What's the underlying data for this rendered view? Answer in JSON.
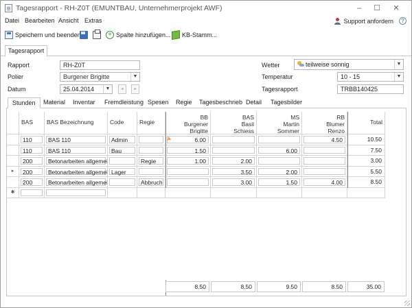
{
  "window": {
    "title": "Tagesrapport - RH-Z0T (EMUNTBAU, Unternehmerprojekt AWF)",
    "minimize": "–",
    "maximize": "☐",
    "close": "✕"
  },
  "menu": {
    "items": [
      "Datei",
      "Bearbeiten",
      "Ansicht",
      "Extras"
    ],
    "support_label": "Support anfordern",
    "help_label": "?"
  },
  "toolbar": {
    "save_close_label": "Speichern und beenden",
    "add_column_label": "Spalte hinzufügen...",
    "kb_label": "KB-Stamm..."
  },
  "main_tab": "Tagesrapport",
  "form": {
    "rapport_label": "Rapport",
    "rapport_value": "RH-Z0T",
    "polier_label": "Polier",
    "polier_value": "Burgener Brigitte",
    "datum_label": "Datum",
    "datum_value": "25.04.2014",
    "wetter_label": "Wetter",
    "wetter_value": "teilweise sonnig",
    "temperatur_label": "Temperatur",
    "temperatur_value": "10 - 15",
    "tagesrapport_label": "Tagesrapport",
    "tagesrapport_value": "TRBB140425"
  },
  "subtabs": [
    "Stunden",
    "Material",
    "Inventar",
    "Fremdleistung",
    "Spesen",
    "Regie",
    "Tagesbeschrieb",
    "Detail",
    "Tagesbilder"
  ],
  "grid": {
    "headers": {
      "bas": "BAS",
      "bas_bez": "BAS Bezeichnung",
      "code": "Code",
      "regie": "Regie",
      "p1": [
        "BB",
        "Burgener",
        "Brigitte"
      ],
      "p2": [
        "BAS",
        "Basil",
        "Schiess"
      ],
      "p3": [
        "MS",
        "Martin",
        "Sommer"
      ],
      "p4": [
        "RB",
        "Blumer",
        "Renzo"
      ],
      "total": "Total"
    },
    "rows": [
      {
        "bas": "110",
        "bez": "BAS 110",
        "code": "Admin",
        "regie": "",
        "p1": "6.00",
        "p2": "",
        "p3": "",
        "p4": "4.50",
        "total": "10.50"
      },
      {
        "bas": "110",
        "bez": "BAS 110",
        "code": "Bau",
        "regie": "",
        "p1": "1.50",
        "p2": "",
        "p3": "6.00",
        "p4": "",
        "total": "7.50"
      },
      {
        "bas": "200",
        "bez": "Betonarbeiten allgemein",
        "code": "",
        "regie": "Regie",
        "p1": "1.00",
        "p2": "2.00",
        "p3": "",
        "p4": "",
        "total": "3.00"
      },
      {
        "bas": "200",
        "bez": "Betonarbeiten allgemein",
        "code": "Lager",
        "regie": "",
        "p1": "",
        "p2": "3.50",
        "p3": "2.00",
        "p4": "",
        "total": "5.50"
      },
      {
        "bas": "200",
        "bez": "Betonarbeiten allgemein",
        "code": "",
        "regie": "Abbruch",
        "p1": "",
        "p2": "3.00",
        "p3": "1.50",
        "p4": "4.00",
        "total": "8.50"
      }
    ],
    "row_indicator": "▸",
    "new_row_indicator": "✱",
    "sums": {
      "p1": "8.50",
      "p2": "8.50",
      "p3": "9.50",
      "p4": "8.50",
      "total": "35.00"
    }
  }
}
